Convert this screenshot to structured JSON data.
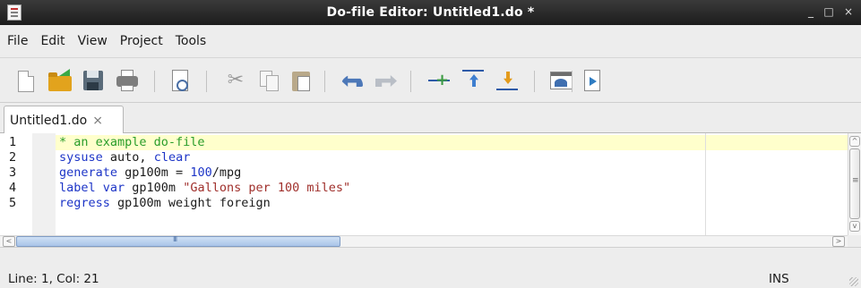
{
  "window": {
    "title": "Do-file Editor: Untitled1.do *",
    "controls": {
      "minimize": "_",
      "maximize": "□",
      "close": "×"
    }
  },
  "menu": {
    "items": [
      {
        "label": "File"
      },
      {
        "label": "Edit"
      },
      {
        "label": "View"
      },
      {
        "label": "Project"
      },
      {
        "label": "Tools"
      }
    ]
  },
  "toolbar": {
    "buttons": [
      {
        "icon": "new-file-icon"
      },
      {
        "icon": "open-folder-icon"
      },
      {
        "icon": "save-icon"
      },
      {
        "icon": "print-icon"
      },
      {
        "icon": "print-preview-icon"
      },
      {
        "icon": "cut-icon"
      },
      {
        "icon": "copy-icon"
      },
      {
        "icon": "paste-icon"
      },
      {
        "icon": "undo-icon"
      },
      {
        "icon": "redo-icon"
      },
      {
        "icon": "toggle-bookmark-icon"
      },
      {
        "icon": "previous-bookmark-icon"
      },
      {
        "icon": "next-bookmark-icon"
      },
      {
        "icon": "show-dofile-icon"
      },
      {
        "icon": "execute-icon"
      }
    ]
  },
  "tabs": [
    {
      "label": "Untitled1.do",
      "close": "⨯"
    }
  ],
  "editor": {
    "line_numbers": [
      "1",
      "2",
      "3",
      "4",
      "5"
    ],
    "lines": [
      [
        {
          "t": "* an example do-file",
          "k": "comment"
        }
      ],
      [
        {
          "t": "sysuse",
          "k": "kw"
        },
        {
          "t": " auto, ",
          "k": "plain"
        },
        {
          "t": "clear",
          "k": "kw"
        }
      ],
      [
        {
          "t": "generate",
          "k": "kw"
        },
        {
          "t": " gp100m = ",
          "k": "plain"
        },
        {
          "t": "100",
          "k": "num"
        },
        {
          "t": "/mpg",
          "k": "plain"
        }
      ],
      [
        {
          "t": "label var",
          "k": "kw"
        },
        {
          "t": " gp100m ",
          "k": "plain"
        },
        {
          "t": "\"Gallons per 100 miles\"",
          "k": "str"
        }
      ],
      [
        {
          "t": "regress",
          "k": "kw"
        },
        {
          "t": " gp100m weight foreign",
          "k": "plain"
        }
      ]
    ],
    "current_line": 1,
    "colors": {
      "comment": "#2a9d2a",
      "keyword": "#1d35c7",
      "string": "#a0302c",
      "current_line_bg": "#ffffcc"
    }
  },
  "scrollbars": {
    "left_arrow": "<",
    "right_arrow": ">",
    "up_arrow": "^",
    "down_arrow": "v"
  },
  "status": {
    "position": "Line: 1, Col: 21",
    "mode": "INS"
  }
}
